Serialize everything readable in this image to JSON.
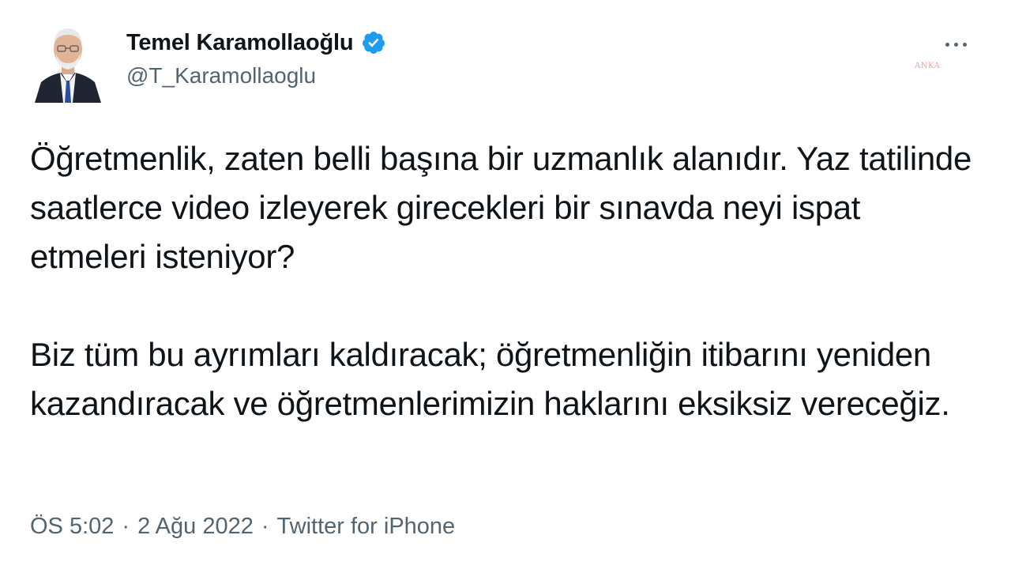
{
  "author": {
    "display_name": "Temel Karamollaoğlu",
    "handle": "@T_Karamollaoglu",
    "verified_icon": "verified-badge-icon"
  },
  "more_icon": "more-horizontal-icon",
  "watermark": "ANKA",
  "tweet": {
    "paragraphs": [
      "Öğretmenlik, zaten belli başına bir uzmanlık alanıdır. Yaz tatilinde saatlerce video izleyerek girecekleri bir sınavda neyi ispat etmeleri isteniyor?",
      "Biz tüm bu ayrımları kaldıracak; öğretmenliğin itibarını yeniden kazandıracak ve öğretmenlerimizin haklarını eksiksiz vereceğiz."
    ],
    "time": "ÖS 5:02",
    "date": "2 Ağu 2022",
    "source": "Twitter for iPhone",
    "separator": "·"
  },
  "colors": {
    "text": "#0f1419",
    "secondary": "#536471",
    "verified": "#1d9bf0"
  }
}
